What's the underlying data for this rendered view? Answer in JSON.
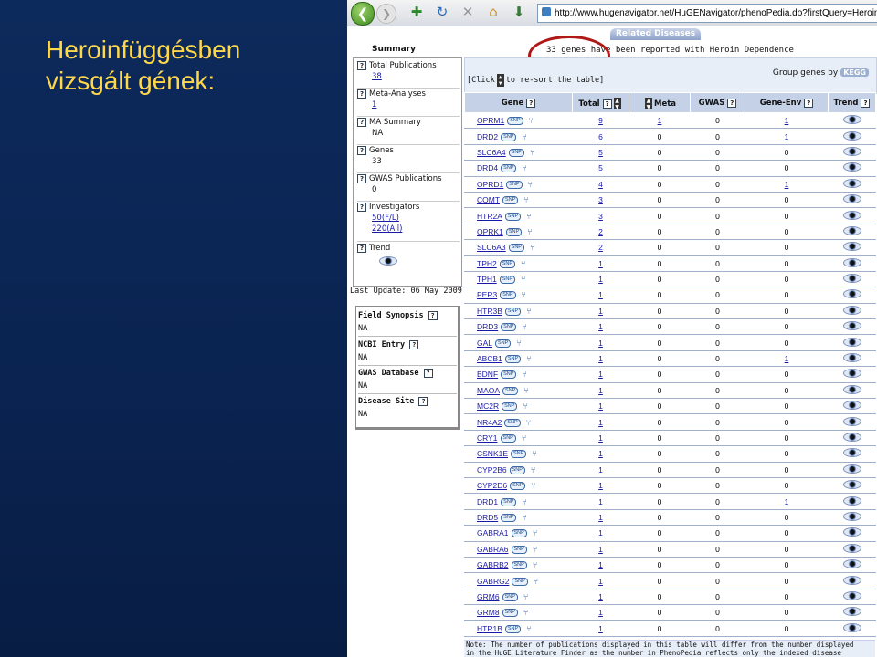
{
  "slide": {
    "title_line1": "Heroinfüggésben",
    "title_line2": "vizsgált gének:"
  },
  "browser": {
    "url": "http://www.hugenavigator.net/HuGENavigator/phenoPedia.do?firstQuery=Heroin Dependence",
    "back_glyph": "❮",
    "forward_glyph": "❯",
    "toolbar_icons": [
      "add-bookmark-icon",
      "refresh-icon",
      "stop-icon",
      "home-icon",
      "download-icon"
    ]
  },
  "page": {
    "related_tab": "Related Diseases",
    "summary_title": "Summary",
    "headline": "33 genes have been reported with Heroin Dependence",
    "summary_items": [
      {
        "label": "Total Publications",
        "value": "38",
        "link": true
      },
      {
        "label": "Meta-Analyses",
        "value": "1",
        "link": true
      },
      {
        "label": "MA Summary",
        "value": "NA",
        "link": false
      },
      {
        "label": "Genes",
        "value": "33",
        "link": false
      },
      {
        "label": "GWAS Publications",
        "value": "0",
        "link": false
      },
      {
        "label": "Investigators",
        "value": "50(F/L)",
        "value2": "220(All)",
        "link": true
      },
      {
        "label": "Trend",
        "value": "",
        "link": false
      }
    ],
    "last_update": "Last Update: 06 May 2009",
    "info_boxes": [
      {
        "label": "Field Synopsis",
        "value": "NA"
      },
      {
        "label": "NCBI Entry",
        "value": "NA"
      },
      {
        "label": "GWAS Database",
        "value": "NA"
      },
      {
        "label": "Disease Site",
        "value": "NA"
      }
    ],
    "click_hint_pre": "[Click",
    "click_hint_post": "to re-sort the table]",
    "group_by_label": "Group genes by",
    "kegg_label": "KEGG",
    "columns": [
      "Gene",
      "Total",
      "Meta",
      "GWAS",
      "Gene-Env",
      "Trend"
    ],
    "snp_label": "SNP",
    "tree_glyph": "⑂",
    "rows": [
      {
        "gene": "OPRM1",
        "total": "9",
        "meta": "1",
        "gwas": "0",
        "geneenv": "1"
      },
      {
        "gene": "DRD2",
        "total": "6",
        "meta": "0",
        "gwas": "0",
        "geneenv": "1"
      },
      {
        "gene": "SLC6A4",
        "total": "5",
        "meta": "0",
        "gwas": "0",
        "geneenv": "0"
      },
      {
        "gene": "DRD4",
        "total": "5",
        "meta": "0",
        "gwas": "0",
        "geneenv": "0"
      },
      {
        "gene": "OPRD1",
        "total": "4",
        "meta": "0",
        "gwas": "0",
        "geneenv": "1"
      },
      {
        "gene": "COMT",
        "total": "3",
        "meta": "0",
        "gwas": "0",
        "geneenv": "0"
      },
      {
        "gene": "HTR2A",
        "total": "3",
        "meta": "0",
        "gwas": "0",
        "geneenv": "0"
      },
      {
        "gene": "OPRK1",
        "total": "2",
        "meta": "0",
        "gwas": "0",
        "geneenv": "0"
      },
      {
        "gene": "SLC6A3",
        "total": "2",
        "meta": "0",
        "gwas": "0",
        "geneenv": "0"
      },
      {
        "gene": "TPH2",
        "total": "1",
        "meta": "0",
        "gwas": "0",
        "geneenv": "0"
      },
      {
        "gene": "TPH1",
        "total": "1",
        "meta": "0",
        "gwas": "0",
        "geneenv": "0"
      },
      {
        "gene": "PER3",
        "total": "1",
        "meta": "0",
        "gwas": "0",
        "geneenv": "0"
      },
      {
        "gene": "HTR3B",
        "total": "1",
        "meta": "0",
        "gwas": "0",
        "geneenv": "0"
      },
      {
        "gene": "DRD3",
        "total": "1",
        "meta": "0",
        "gwas": "0",
        "geneenv": "0"
      },
      {
        "gene": "GAL",
        "total": "1",
        "meta": "0",
        "gwas": "0",
        "geneenv": "0"
      },
      {
        "gene": "ABCB1",
        "total": "1",
        "meta": "0",
        "gwas": "0",
        "geneenv": "1"
      },
      {
        "gene": "BDNF",
        "total": "1",
        "meta": "0",
        "gwas": "0",
        "geneenv": "0"
      },
      {
        "gene": "MAOA",
        "total": "1",
        "meta": "0",
        "gwas": "0",
        "geneenv": "0"
      },
      {
        "gene": "MC2R",
        "total": "1",
        "meta": "0",
        "gwas": "0",
        "geneenv": "0"
      },
      {
        "gene": "NR4A2",
        "total": "1",
        "meta": "0",
        "gwas": "0",
        "geneenv": "0"
      },
      {
        "gene": "CRY1",
        "total": "1",
        "meta": "0",
        "gwas": "0",
        "geneenv": "0"
      },
      {
        "gene": "CSNK1E",
        "total": "1",
        "meta": "0",
        "gwas": "0",
        "geneenv": "0"
      },
      {
        "gene": "CYP2B6",
        "total": "1",
        "meta": "0",
        "gwas": "0",
        "geneenv": "0"
      },
      {
        "gene": "CYP2D6",
        "total": "1",
        "meta": "0",
        "gwas": "0",
        "geneenv": "0"
      },
      {
        "gene": "DRD1",
        "total": "1",
        "meta": "0",
        "gwas": "0",
        "geneenv": "1"
      },
      {
        "gene": "DRD5",
        "total": "1",
        "meta": "0",
        "gwas": "0",
        "geneenv": "0"
      },
      {
        "gene": "GABRA1",
        "total": "1",
        "meta": "0",
        "gwas": "0",
        "geneenv": "0"
      },
      {
        "gene": "GABRA6",
        "total": "1",
        "meta": "0",
        "gwas": "0",
        "geneenv": "0"
      },
      {
        "gene": "GABRB2",
        "total": "1",
        "meta": "0",
        "gwas": "0",
        "geneenv": "0"
      },
      {
        "gene": "GABRG2",
        "total": "1",
        "meta": "0",
        "gwas": "0",
        "geneenv": "0"
      },
      {
        "gene": "GRM6",
        "total": "1",
        "meta": "0",
        "gwas": "0",
        "geneenv": "0"
      },
      {
        "gene": "GRM8",
        "total": "1",
        "meta": "0",
        "gwas": "0",
        "geneenv": "0"
      },
      {
        "gene": "HTR1B",
        "total": "1",
        "meta": "0",
        "gwas": "0",
        "geneenv": "0"
      }
    ],
    "note_line1": "Note: The number of publications displayed in this table will differ from the number displayed",
    "note_line2": "in the HuGE Literature Finder as the number in PhenoPedia reflects only the indexed disease"
  }
}
